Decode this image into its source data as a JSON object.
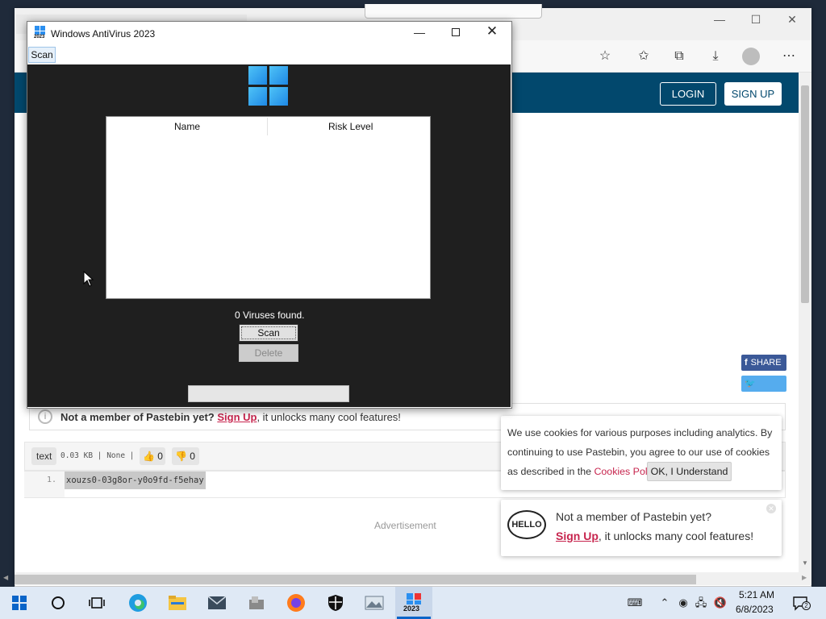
{
  "browser": {
    "controls": {
      "minimize": "—",
      "maximize": "☐",
      "close": "✕"
    },
    "toolbar_icons": [
      "favorite-add-icon",
      "favorites-icon",
      "collections-icon",
      "downloads-icon",
      "profile-icon",
      "more-icon"
    ],
    "header": {
      "login": "LOGIN",
      "signup": "SIGN UP"
    }
  },
  "page": {
    "share": {
      "facebook": "SHARE",
      "twitter": "TWEET"
    },
    "notice": {
      "prefix": "Not a member of Pastebin yet?",
      "link": "Sign Up",
      "suffix": ", it unlocks many cool features!"
    },
    "paste": {
      "syntax": "text",
      "meta": "0.03 KB | None |",
      "likes": "0",
      "dislikes": "0",
      "line_number": "1.",
      "line_content": "xouzs0-03g8or-y0o9fd-f5ehay"
    },
    "advertisement": "Advertisement"
  },
  "cookie_popup": {
    "text_before": "We use cookies for various purposes including analytics. By continuing to use Pastebin, you agree to our use of cookies as described in the",
    "link": "Cookies Policy",
    "text_after": ".",
    "button": "OK, I Understand"
  },
  "member_popup": {
    "bubble": "HELLO",
    "line1": "Not a member of Pastebin yet?",
    "link": "Sign Up",
    "line2_suffix": ", it unlocks many cool features!"
  },
  "antivirus": {
    "title": "Windows AntiVirus 2023",
    "icon_label": "2023",
    "menu": [
      "Scan"
    ],
    "columns": [
      "Name",
      "Risk Level"
    ],
    "rows": [],
    "status": "0 Viruses found.",
    "scan_button": "Scan",
    "delete_button": "Delete",
    "progress": 0
  },
  "taskbar": {
    "active_label": "2023",
    "time": "5:21 AM",
    "date": "6/8/2023",
    "notifications": "2"
  }
}
